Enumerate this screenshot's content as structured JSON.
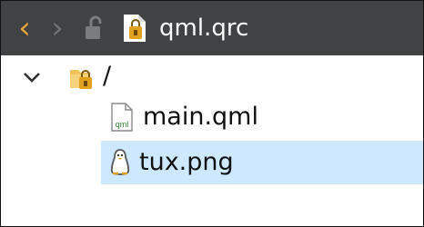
{
  "toolbar": {
    "back_icon": "chevron-left-icon",
    "forward_icon": "chevron-right-icon",
    "lock_icon": "unlocked-icon",
    "file_icon": "qrc-resource-file-icon",
    "title": "qml.qrc",
    "background": "#404244",
    "back_color": "#e6a23c"
  },
  "tree": {
    "root": {
      "expander_icon": "chevron-down-icon",
      "folder_icon": "locked-folder-icon",
      "label": "/"
    },
    "items": [
      {
        "icon": "qml-file-icon",
        "icon_text": "qml",
        "label": "main.qml",
        "selected": false
      },
      {
        "icon": "penguin-icon",
        "label": "tux.png",
        "selected": true
      }
    ],
    "selection_color": "#cde8ff"
  }
}
